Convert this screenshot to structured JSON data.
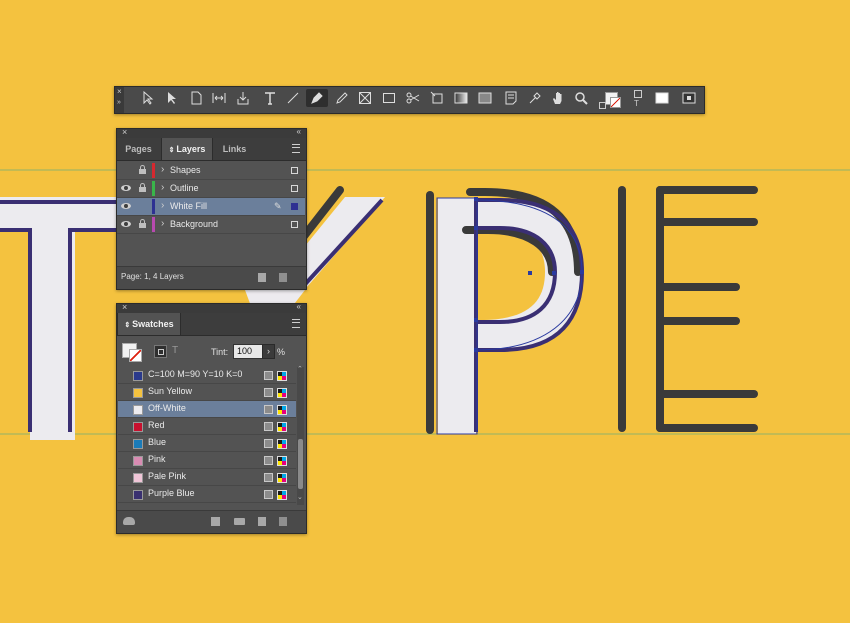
{
  "canvas": {
    "background": "#f4c23f"
  },
  "toolbar": {
    "tools": [
      "selection",
      "direct-selection",
      "page",
      "gap",
      "content-collector",
      "type",
      "line",
      "pen",
      "pencil",
      "rectangle-frame",
      "rectangle",
      "scissors",
      "free-transform",
      "gradient-swatch",
      "gradient-feather",
      "note",
      "eyedropper",
      "hand",
      "zoom"
    ]
  },
  "layers_panel": {
    "tabs": {
      "pages": "Pages",
      "layers": "Layers",
      "links": "Links"
    },
    "layers": [
      {
        "name": "Shapes",
        "color": "#d6282f",
        "visible": false,
        "locked": true,
        "selected": false
      },
      {
        "name": "Outline",
        "color": "#39b54a",
        "visible": true,
        "locked": true,
        "selected": false
      },
      {
        "name": "White Fill",
        "color": "#2e3192",
        "visible": true,
        "locked": false,
        "selected": true
      },
      {
        "name": "Background",
        "color": "#b84ab0",
        "visible": true,
        "locked": true,
        "selected": false
      }
    ],
    "status": "Page: 1, 4 Layers"
  },
  "swatches_panel": {
    "title": "Swatches",
    "tint_label": "Tint:",
    "tint_value": "100",
    "tint_unit": "%",
    "swatches": [
      {
        "name": "C=100 M=90 Y=10 K=0",
        "color": "#2b3a8c",
        "selected": false
      },
      {
        "name": "Sun Yellow",
        "color": "#f4c23f",
        "selected": false
      },
      {
        "name": "Off-White",
        "color": "#ecebef",
        "selected": true
      },
      {
        "name": "Red",
        "color": "#c8102e",
        "selected": false
      },
      {
        "name": "Blue",
        "color": "#1b7bb8",
        "selected": false
      },
      {
        "name": "Pink",
        "color": "#d98cb3",
        "selected": false
      },
      {
        "name": "Pale Pink",
        "color": "#f0c6d8",
        "selected": false
      },
      {
        "name": "Purple Blue",
        "color": "#3a3170",
        "selected": false
      }
    ]
  },
  "artwork": {
    "letters": [
      "T",
      "Y",
      "P",
      "E"
    ],
    "colors": {
      "outline": "#3a3a3a",
      "fill": "#ecebef",
      "path": "#3a2f73",
      "guide": "#7fb069"
    }
  }
}
